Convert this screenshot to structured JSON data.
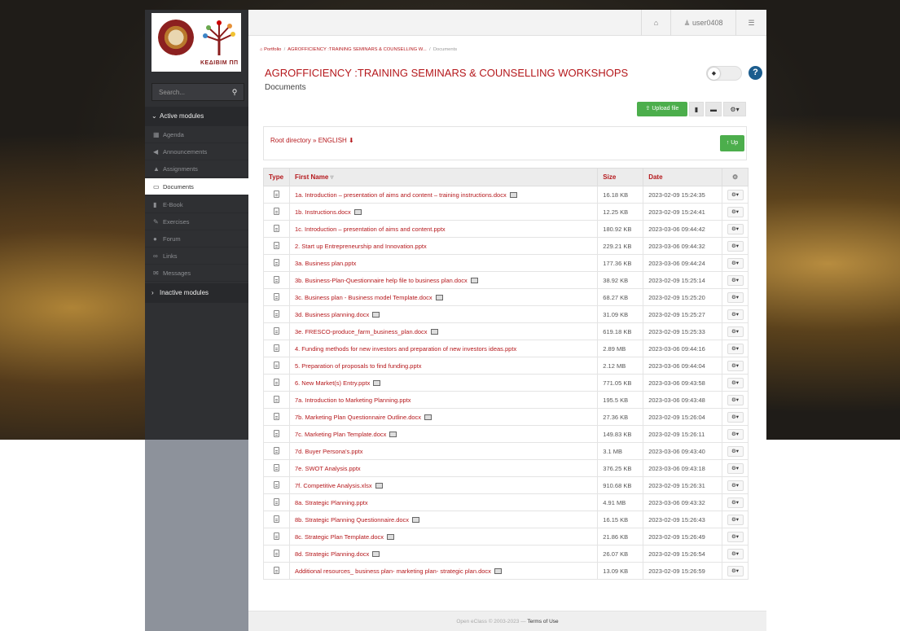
{
  "logo": {
    "text": "ΚΕΔΙΒΙΜ ΠΠ"
  },
  "search": {
    "placeholder": "Search..."
  },
  "sidebar": {
    "active_heading": "Active modules",
    "inactive_heading": "Inactive modules",
    "items": [
      {
        "label": "Agenda",
        "icon": "calendar-icon"
      },
      {
        "label": "Announcements",
        "icon": "bullhorn-icon"
      },
      {
        "label": "Assignments",
        "icon": "flask-icon"
      },
      {
        "label": "Documents",
        "icon": "folder-open-icon"
      },
      {
        "label": "E-Book",
        "icon": "book-icon"
      },
      {
        "label": "Exercises",
        "icon": "pencil-square-icon"
      },
      {
        "label": "Forum",
        "icon": "comments-icon"
      },
      {
        "label": "Links",
        "icon": "link-icon"
      },
      {
        "label": "Messages",
        "icon": "envelope-icon"
      }
    ]
  },
  "topbar": {
    "user": "user0408"
  },
  "breadcrumb": {
    "portfolio": "Portfolio",
    "course": "AGROFFICIENCY :TRAINING SEMINARS & COUNSELLING W...",
    "current": "Documents"
  },
  "page": {
    "title": "AGROFFICIENCY :TRAINING SEMINARS & COUNSELLING WORKSHOPS",
    "subtitle": "Documents"
  },
  "toolbar": {
    "upload_label": "Upload file"
  },
  "path": {
    "text": "Root directory » ENGLISH",
    "up_label": "Up"
  },
  "table": {
    "headers": {
      "type": "Type",
      "name": "First Name",
      "size": "Size",
      "date": "Date"
    },
    "rows": [
      {
        "name": "1a. Introduction – presentation of aims and content – training instructions.docx",
        "size": "16.18 KB",
        "date": "2023-02-09 15:24:35",
        "preview": true
      },
      {
        "name": "1b. Instructions.docx",
        "size": "12.25 KB",
        "date": "2023-02-09 15:24:41",
        "preview": true
      },
      {
        "name": "1c. Introduction – presentation of aims and content.pptx",
        "size": "180.92 KB",
        "date": "2023-03-06 09:44:42",
        "preview": false
      },
      {
        "name": "2. Start up Entrepreneurship and Innovation.pptx",
        "size": "229.21 KB",
        "date": "2023-03-06 09:44:32",
        "preview": false
      },
      {
        "name": "3a. Business plan.pptx",
        "size": "177.36 KB",
        "date": "2023-03-06 09:44:24",
        "preview": false
      },
      {
        "name": "3b. Business-Plan-Questionnaire help file to business plan.docx",
        "size": "38.92 KB",
        "date": "2023-02-09 15:25:14",
        "preview": true
      },
      {
        "name": "3c. Business plan - Business model Template.docx",
        "size": "68.27 KB",
        "date": "2023-02-09 15:25:20",
        "preview": true
      },
      {
        "name": "3d. Business planning.docx",
        "size": "31.09 KB",
        "date": "2023-02-09 15:25:27",
        "preview": true
      },
      {
        "name": "3e. FRESCO-produce_farm_business_plan.docx",
        "size": "619.18 KB",
        "date": "2023-02-09 15:25:33",
        "preview": true
      },
      {
        "name": "4. Funding methods for new investors and preparation of new investors ideas.pptx",
        "size": "2.89 MB",
        "date": "2023-03-06 09:44:16",
        "preview": false
      },
      {
        "name": "5. Preparation of proposals to find funding.pptx",
        "size": "2.12 MB",
        "date": "2023-03-06 09:44:04",
        "preview": false
      },
      {
        "name": "6. New Market(s) Entry.pptx",
        "size": "771.05 KB",
        "date": "2023-03-06 09:43:58",
        "preview": true
      },
      {
        "name": "7a. Introduction to Marketing Planning.pptx",
        "size": "195.5 KB",
        "date": "2023-03-06 09:43:48",
        "preview": false
      },
      {
        "name": "7b. Marketing Plan Questionnaire Outline.docx",
        "size": "27.36 KB",
        "date": "2023-02-09 15:26:04",
        "preview": true
      },
      {
        "name": "7c. Marketing Plan Template.docx",
        "size": "149.83 KB",
        "date": "2023-02-09 15:26:11",
        "preview": true
      },
      {
        "name": "7d. Buyer Persona's.pptx",
        "size": "3.1 MB",
        "date": "2023-03-06 09:43:40",
        "preview": false
      },
      {
        "name": "7e. SWOT Analysis.pptx",
        "size": "376.25 KB",
        "date": "2023-03-06 09:43:18",
        "preview": false
      },
      {
        "name": "7f. Competitive Analysis.xlsx",
        "size": "910.68 KB",
        "date": "2023-02-09 15:26:31",
        "preview": true
      },
      {
        "name": "8a. Strategic Planning.pptx",
        "size": "4.91 MB",
        "date": "2023-03-06 09:43:32",
        "preview": false
      },
      {
        "name": "8b. Strategic Planning Questionnaire.docx",
        "size": "16.15 KB",
        "date": "2023-02-09 15:26:43",
        "preview": true
      },
      {
        "name": "8c. Strategic Plan Template.docx",
        "size": "21.86 KB",
        "date": "2023-02-09 15:26:49",
        "preview": true
      },
      {
        "name": "8d. Strategic Planning.docx",
        "size": "26.07 KB",
        "date": "2023-02-09 15:26:54",
        "preview": true
      },
      {
        "name": "Additional resources_ business plan- marketing plan- strategic plan.docx",
        "size": "13.09 KB",
        "date": "2023-02-09 15:26:59",
        "preview": true
      }
    ]
  },
  "footer": {
    "copyright": "Open eClass © 2003-2023 — ",
    "terms": "Terms of Use"
  },
  "colors": {
    "accent": "#b5181c",
    "success": "#4cae4c",
    "sidebar": "#2f3033",
    "help": "#1c5d8e"
  }
}
